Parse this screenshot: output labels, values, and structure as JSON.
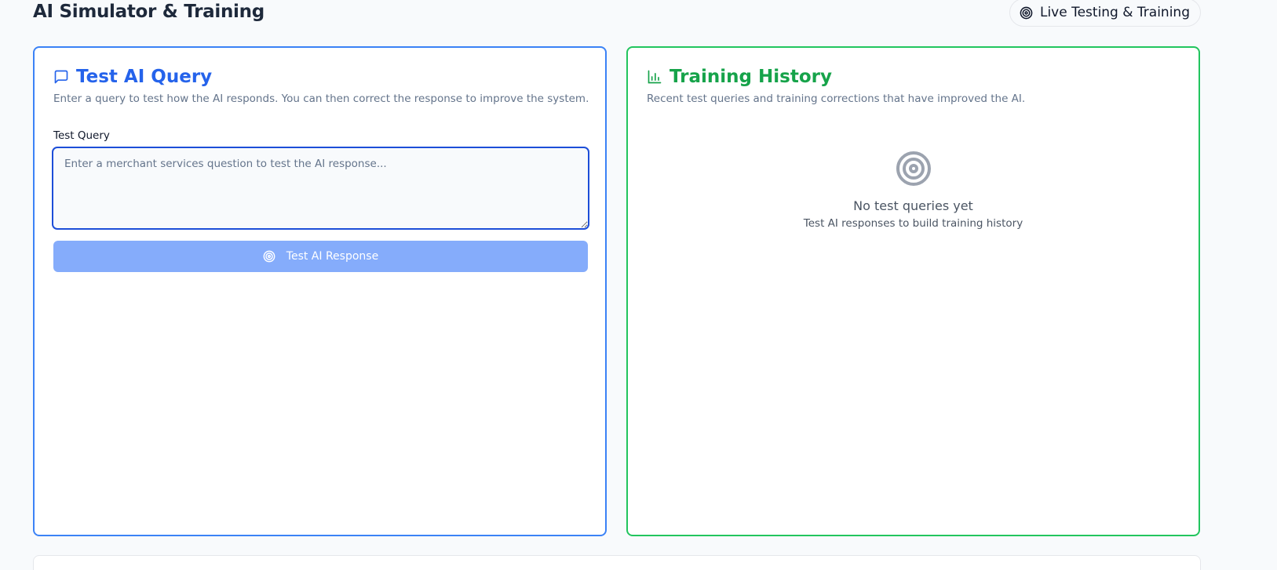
{
  "header": {
    "title": "AI Simulator & Training",
    "badge_label": "Live Testing & Training",
    "badge_icon": "target-icon"
  },
  "test_panel": {
    "title": "Test AI Query",
    "title_icon": "message-square-icon",
    "description": "Enter a query to test how the AI responds. You can then correct the response to improve the system.",
    "query_label": "Test Query",
    "query_value": "",
    "query_placeholder": "Enter a merchant services question to test the AI response...",
    "button_label": "Test AI Response",
    "button_icon": "target-icon",
    "accent_color": "#2563eb"
  },
  "history_panel": {
    "title": "Training History",
    "title_icon": "bar-chart-icon",
    "description": "Recent test queries and training corrections that have improved the AI.",
    "empty_icon": "target-icon",
    "empty_title": "No test queries yet",
    "empty_subtitle": "Test AI responses to build training history",
    "accent_color": "#16a34a"
  }
}
